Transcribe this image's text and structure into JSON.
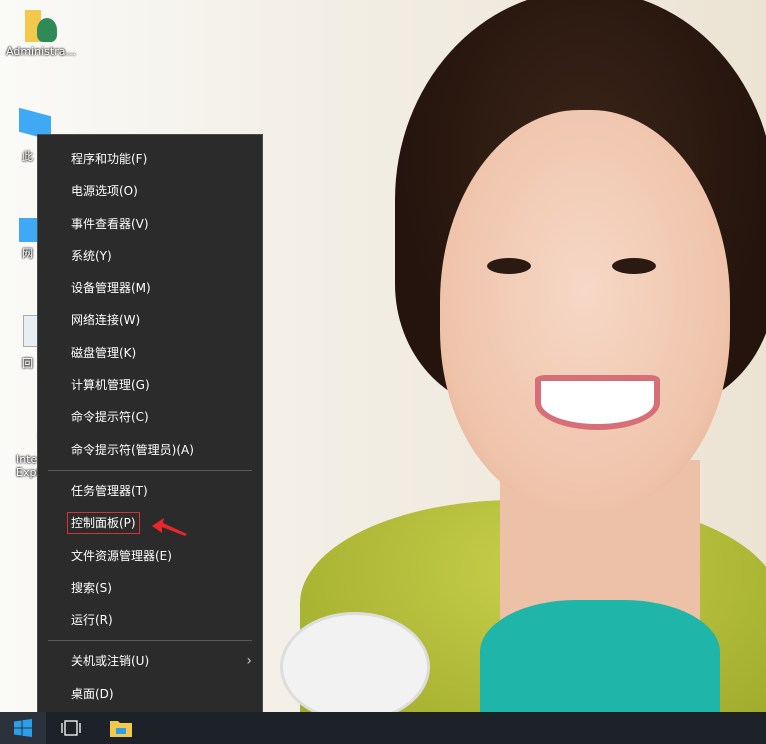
{
  "desktop_icons": [
    {
      "label": "Administra...",
      "icon": "user-folder-icon"
    },
    {
      "label": "此",
      "icon": "this-pc-icon"
    },
    {
      "label": "网",
      "icon": "network-icon"
    },
    {
      "label": "回",
      "icon": "recycle-bin-icon"
    },
    {
      "label": "Inte\nExpl",
      "icon": "internet-explorer-icon"
    }
  ],
  "menu": {
    "group1": [
      "程序和功能(F)",
      "电源选项(O)",
      "事件查看器(V)",
      "系统(Y)",
      "设备管理器(M)",
      "网络连接(W)",
      "磁盘管理(K)",
      "计算机管理(G)",
      "命令提示符(C)",
      "命令提示符(管理员)(A)"
    ],
    "group2": [
      "任务管理器(T)",
      "控制面板(P)",
      "文件资源管理器(E)",
      "搜索(S)",
      "运行(R)"
    ],
    "group3": [
      "关机或注销(U)",
      "桌面(D)"
    ],
    "highlighted": "控制面板(P)"
  },
  "taskbar": {
    "items": [
      "start-icon",
      "task-view-icon",
      "file-explorer-icon"
    ]
  },
  "colors": {
    "menu_bg": "#2b2b2b",
    "highlight_box": "#d2323a",
    "taskbar": "#1d2128",
    "start_blue": "#2b9fe8"
  }
}
